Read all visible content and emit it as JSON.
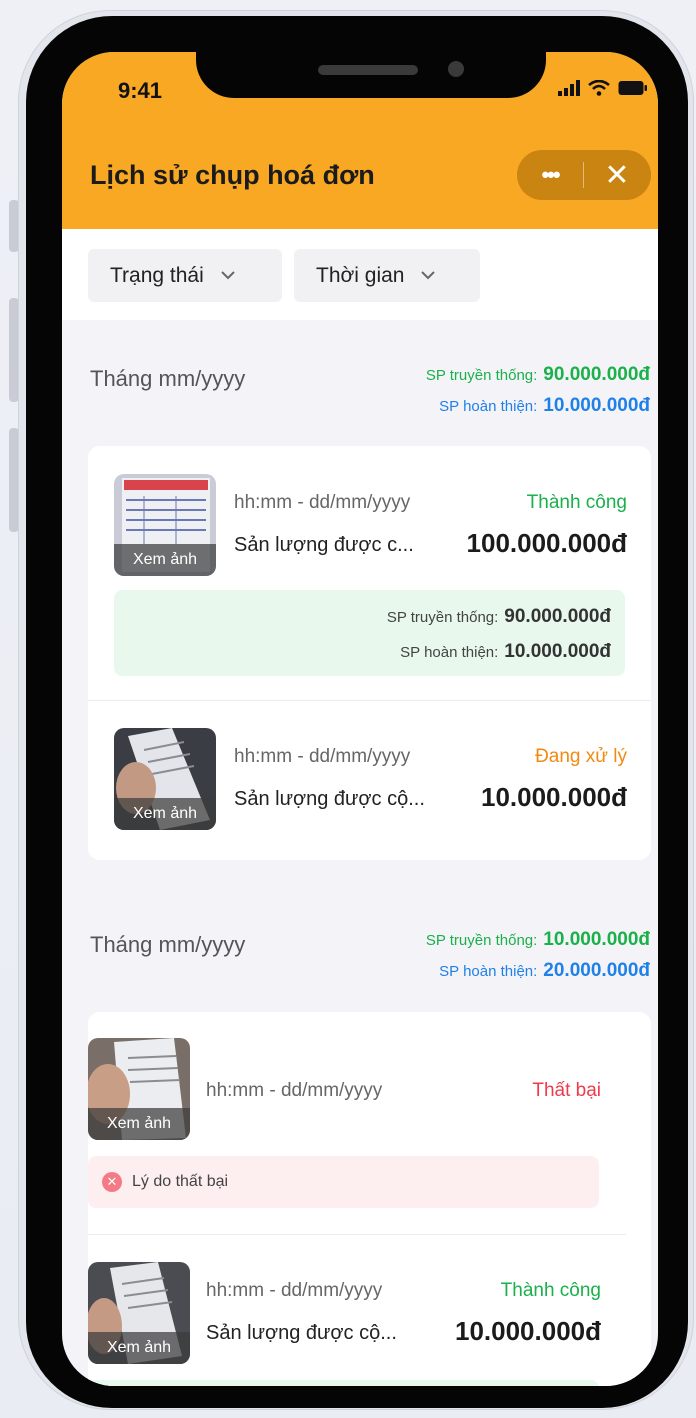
{
  "status_bar": {
    "time": "9:41"
  },
  "header": {
    "title": "Lịch sử chụp hoá đơn",
    "more_icon": "more-dots-icon",
    "close_icon": "close-icon",
    "color": "#f8a823"
  },
  "filters": [
    {
      "label": "Trạng thái"
    },
    {
      "label": "Thời gian"
    }
  ],
  "labels": {
    "traditional": "SP truyền thống:",
    "finished": "SP hoàn thiện:",
    "view_photo": "Xem ảnh"
  },
  "months": [
    {
      "label": "Tháng mm/yyyy",
      "traditional_total": "90.000.000đ",
      "finished_total": "10.000.000đ",
      "items": [
        {
          "time": "hh:mm - dd/mm/yyyy",
          "status": "Thành công",
          "status_color": "#1ab04a",
          "label": "Sản lượng được c...",
          "amount": "100.000.000đ",
          "breakdown": {
            "traditional": "90.000.000đ",
            "finished": "10.000.000đ"
          }
        },
        {
          "time": "hh:mm - dd/mm/yyyy",
          "status": "Đang xử lý",
          "status_color": "#f28a12",
          "label": "Sản lượng được cộ...",
          "amount": "10.000.000đ"
        }
      ]
    },
    {
      "label": "Tháng mm/yyyy",
      "traditional_total": "10.000.000đ",
      "finished_total": "20.000.000đ",
      "items": [
        {
          "time": "hh:mm - dd/mm/yyyy",
          "status": "Thất bại",
          "status_color": "#ee3b4b",
          "fail_reason": "Lý do thất bại"
        },
        {
          "time": "hh:mm - dd/mm/yyyy",
          "status": "Thành công",
          "status_color": "#1ab04a",
          "label": "Sản lượng được cộ...",
          "amount": "10.000.000đ"
        }
      ]
    }
  ]
}
